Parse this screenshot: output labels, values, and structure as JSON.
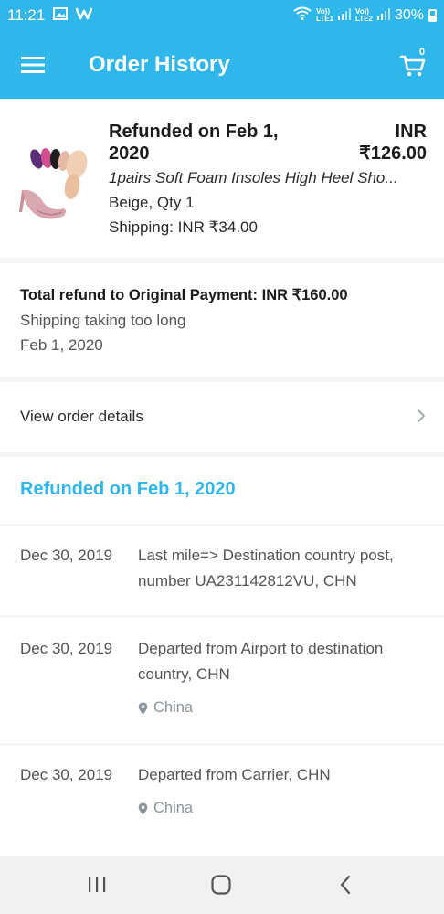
{
  "status_bar": {
    "time": "11:21",
    "sim1_label": "Vo))",
    "sim1_sub": "LTE1",
    "sim2_label": "Vo))",
    "sim2_sub": "LTE2",
    "battery": "30%"
  },
  "app_bar": {
    "title": "Order History",
    "cart_count": "0"
  },
  "item": {
    "status": "Refunded on Feb 1, 2020",
    "currency": "INR",
    "price": "₹126.00",
    "name": "1pairs Soft Foam Insoles High Heel Sho...",
    "variant": "Beige, Qty 1",
    "shipping": "Shipping: INR ₹34.00"
  },
  "refund": {
    "title": "Total refund to Original Payment: INR ₹160.00",
    "reason": "Shipping taking too long",
    "date": "Feb 1, 2020"
  },
  "details": {
    "label": "View order details"
  },
  "tracking": {
    "heading": "Refunded on Feb 1, 2020",
    "events": [
      {
        "date": "Dec 30, 2019",
        "description": "Last mile=> Destination country post, number UA231142812VU, CHN",
        "location": ""
      },
      {
        "date": "Dec 30, 2019",
        "description": "Departed from Airport to destination country, CHN",
        "location": "China"
      },
      {
        "date": "Dec 30, 2019",
        "description": "Departed from Carrier, CHN",
        "location": "China"
      }
    ]
  },
  "colors": {
    "accent": "#2fb7ec",
    "text": "#2b2b2b",
    "muted": "#8a959c"
  }
}
